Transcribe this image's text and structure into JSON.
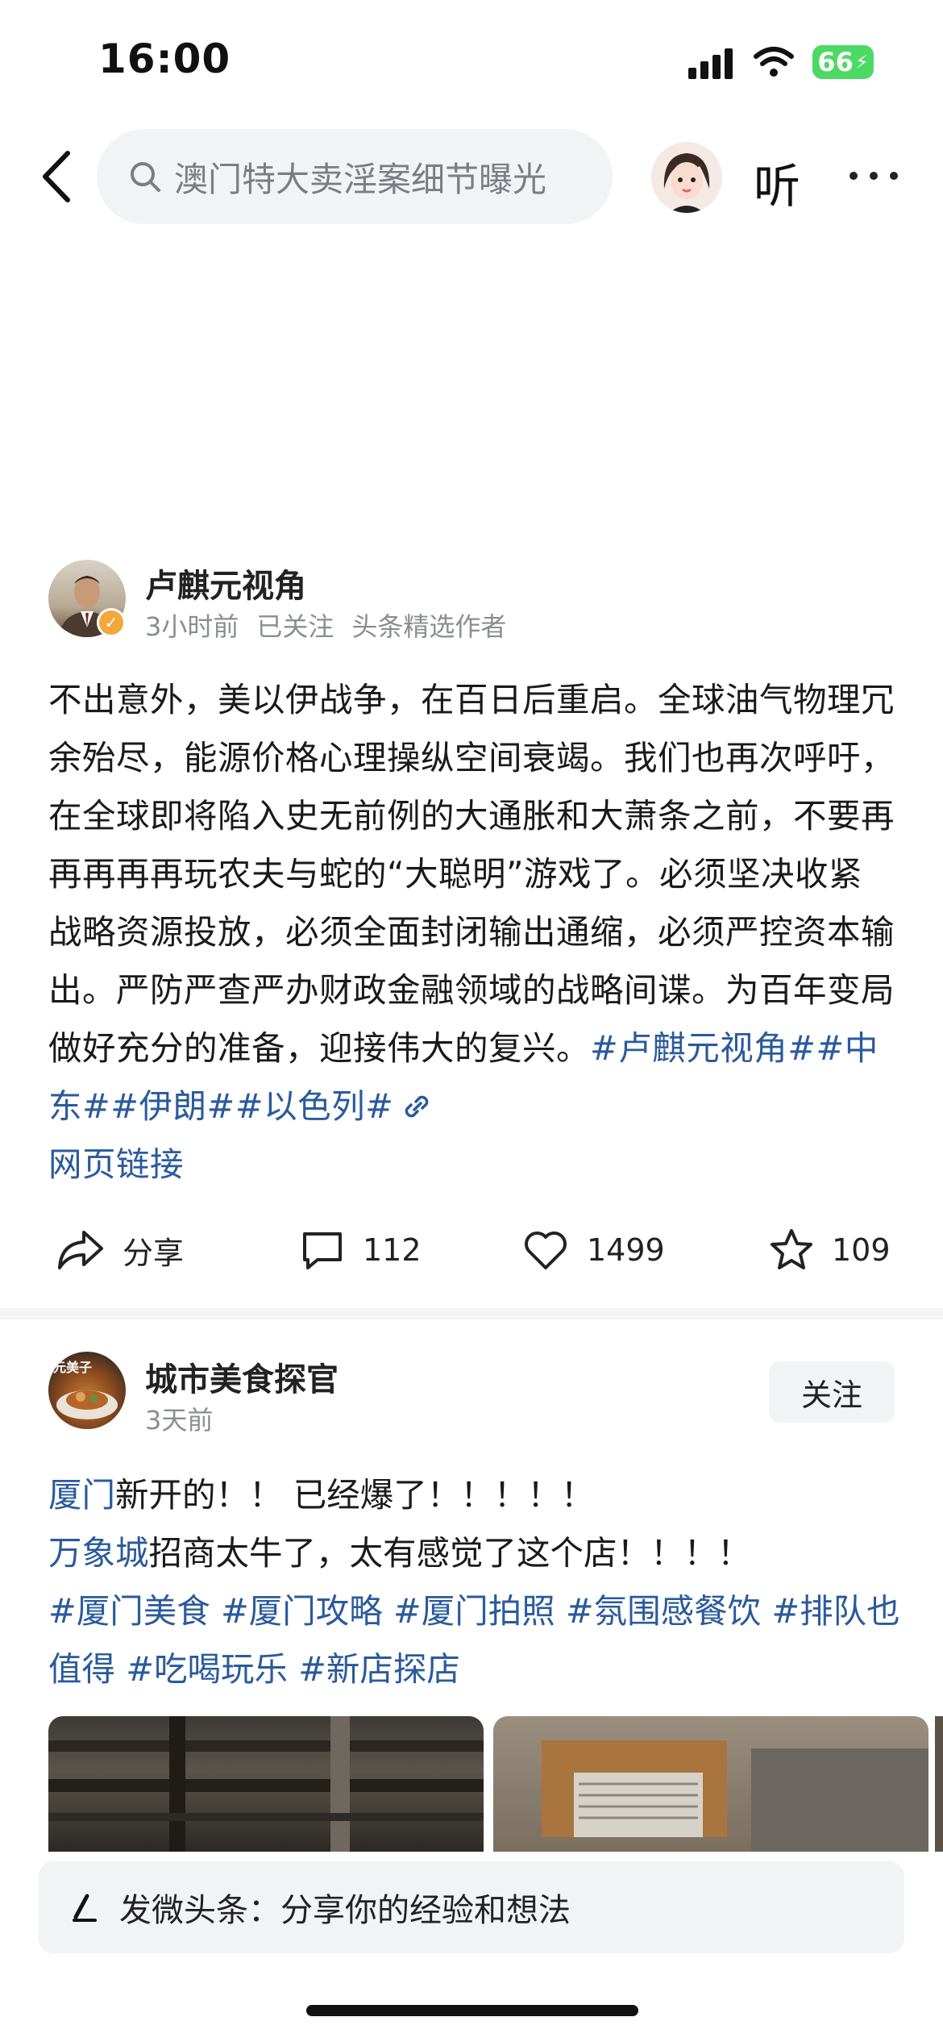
{
  "status_bar": {
    "time": "16:00",
    "battery": "66"
  },
  "search": {
    "query": "澳门特大卖淫案细节曝光"
  },
  "header": {
    "listen_label": "听"
  },
  "post1": {
    "author": "卢麒元视角",
    "meta": [
      "3小时前",
      "已关注",
      "头条精选作者"
    ],
    "body": "不出意外，美以伊战争，在百日后重启。全球油气物理冗余殆尽，能源价格心理操纵空间衰竭。我们也再次呼吁，在全球即将陷入史无前例的大通胀和大萧条之前，不要再再再再再玩农夫与蛇的“大聪明”游戏了。必须坚决收紧战略资源投放，必须全面封闭输出通缩，必须严控资本输出。严防严查严办财政金融领域的战略间谍。为百年变局做好充分的准备，迎接伟大的复兴。",
    "hashtags": "#卢麒元视角##中东##伊朗##以色列#",
    "link_label": "网页链接",
    "actions": {
      "share": "分享",
      "comments": "112",
      "likes": "1499",
      "favorites": "109"
    }
  },
  "post2": {
    "author": "城市美食探官",
    "avatar_text": "元美子",
    "meta": "3天前",
    "follow_label": "关注",
    "line1_link": "厦门",
    "line1_text": "新开的！！ 已经爆了！！！！！",
    "line2_link": "万象城",
    "line2_text": "招商太牛了，太有感觉了这个店！！！！",
    "hashtags": "#厦门美食 #厦门攻略 #厦门拍照 #氛围感餐饮 #排队也值得 #吃喝玩乐 #新店探店"
  },
  "compose": {
    "placeholder": "发微头条：分享你的经验和想法"
  },
  "colors": {
    "link": "#2a5a9c",
    "battery": "#4cd964",
    "muted": "#8a8d93"
  }
}
